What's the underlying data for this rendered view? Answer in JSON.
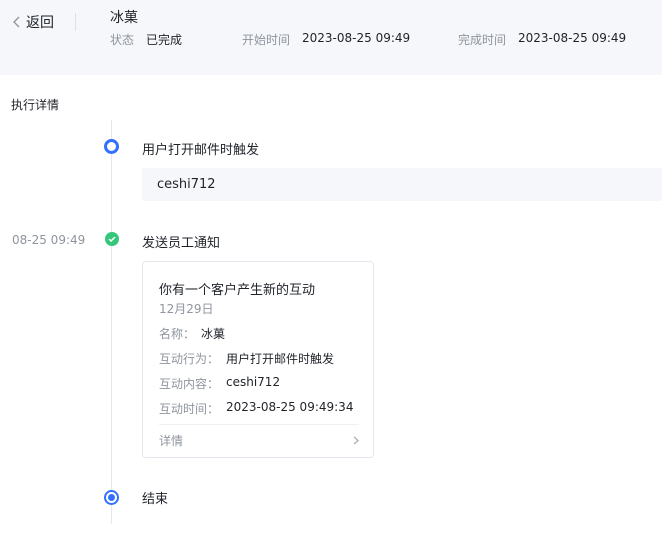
{
  "header": {
    "back_label": "返回",
    "title": "冰菓",
    "status_key": "状态",
    "status_value": "已完成",
    "start_key": "开始时间",
    "start_value": "2023-08-25 09:49",
    "end_key": "完成时间",
    "end_value": "2023-08-25 09:49"
  },
  "section_title": "执行详情",
  "steps": [
    {
      "label": "用户打开邮件时触发",
      "content": "ceshi712"
    },
    {
      "time": "08-25 09:49",
      "label": "发送员工通知"
    },
    {
      "label": "结束"
    }
  ],
  "card": {
    "title": "你有一个客户产生新的互动",
    "date": "12月29日",
    "rows": [
      {
        "key": "名称：",
        "value": "冰菓"
      },
      {
        "key": "互动行为：",
        "value": "用户打开邮件时触发"
      },
      {
        "key": "互动内容：",
        "value": "ceshi712"
      },
      {
        "key": "互动时间：",
        "value": "2023-08-25 09:49:34"
      }
    ],
    "footer_label": "详情"
  },
  "colors": {
    "accent": "#3370ff",
    "success": "#34c77b",
    "muted": "#8f959e",
    "header_bg": "#f5f7fa"
  },
  "icons": [
    "chevron-left-icon",
    "check-icon",
    "chevron-right-icon"
  ]
}
